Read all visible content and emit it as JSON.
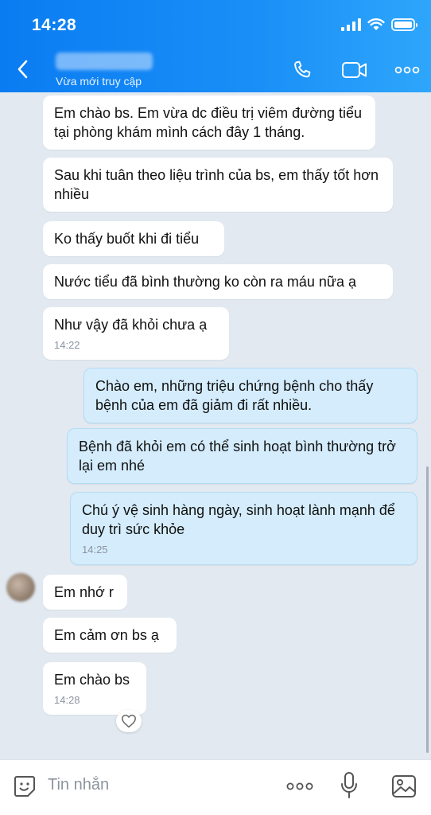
{
  "status_bar": {
    "time": "14:28"
  },
  "header": {
    "contact_status": "Vừa mới truy cập"
  },
  "messages": [
    {
      "dir": "in",
      "text": "Em chào bs. Em vừa dc điều trị viêm đường tiểu tại phòng khám mình cách đây 1 tháng.",
      "time": ""
    },
    {
      "dir": "in",
      "text": "Sau khi tuân theo liệu trình của bs, em thấy tốt hơn nhiều",
      "time": ""
    },
    {
      "dir": "in",
      "text": "Ko thấy buốt khi đi tiểu",
      "time": ""
    },
    {
      "dir": "in",
      "text": "Nước tiểu đã bình thường ko còn ra máu nữa ạ",
      "time": ""
    },
    {
      "dir": "in",
      "text": "Như vậy đã khỏi chưa ạ",
      "time": "14:22"
    },
    {
      "dir": "out",
      "text": "Chào em, những triệu chứng bệnh cho thấy bệnh của em đã giảm đi rất nhiều.",
      "time": ""
    },
    {
      "dir": "out",
      "text": "Bệnh đã khỏi em có thể sinh hoạt bình thường trở lại em nhé",
      "time": ""
    },
    {
      "dir": "out",
      "text": "Chú ý vệ sinh hàng ngày, sinh hoạt lành mạnh để duy trì sức khỏe",
      "time": "14:25"
    },
    {
      "dir": "in",
      "text": "Em nhớ r",
      "time": ""
    },
    {
      "dir": "in",
      "text": "Em cảm ơn bs ạ",
      "time": ""
    },
    {
      "dir": "in",
      "text": "Em chào bs",
      "time": "14:28"
    }
  ],
  "input": {
    "placeholder": "Tin nhắn"
  },
  "icons": {
    "back": "chevron-left-icon",
    "call": "phone-icon",
    "video": "video-camera-icon",
    "more": "more-dots-icon",
    "sticker": "sticker-smile-icon",
    "mic": "microphone-icon",
    "image": "image-icon",
    "heart": "heart-icon"
  },
  "colors": {
    "header": "#0a7cf2",
    "incoming_bubble": "#ffffff",
    "outgoing_bubble": "#d4ecfc",
    "chat_background": "#e2e9f1"
  }
}
